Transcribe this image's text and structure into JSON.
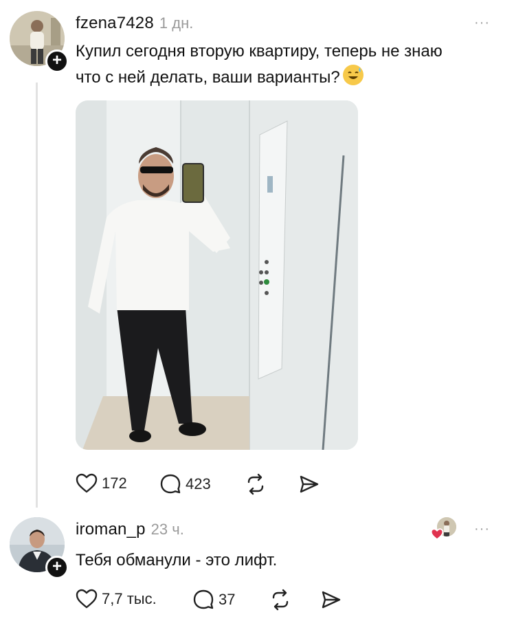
{
  "post": {
    "username": "fzena7428",
    "time": "1 дн.",
    "more": "···",
    "text_line1": "Купил сегодня вторую квартиру, теперь не знаю",
    "text_line2": "что с ней делать, ваши варианты?",
    "emoji": "😅",
    "likes": "172",
    "comments": "423"
  },
  "reply": {
    "username": "iroman_p",
    "time": "23 ч.",
    "more": "···",
    "text": "Тебя обманули - это лифт.",
    "likes": "7,7 тыс.",
    "comments": "37"
  },
  "icons": {
    "like": "heart-icon",
    "comment": "comment-bubble-icon",
    "repost": "repost-icon",
    "share": "send-icon",
    "follow": "plus-icon"
  },
  "colors": {
    "text": "#111111",
    "muted": "#9a9a9a",
    "liked_heart": "#e0334f"
  }
}
